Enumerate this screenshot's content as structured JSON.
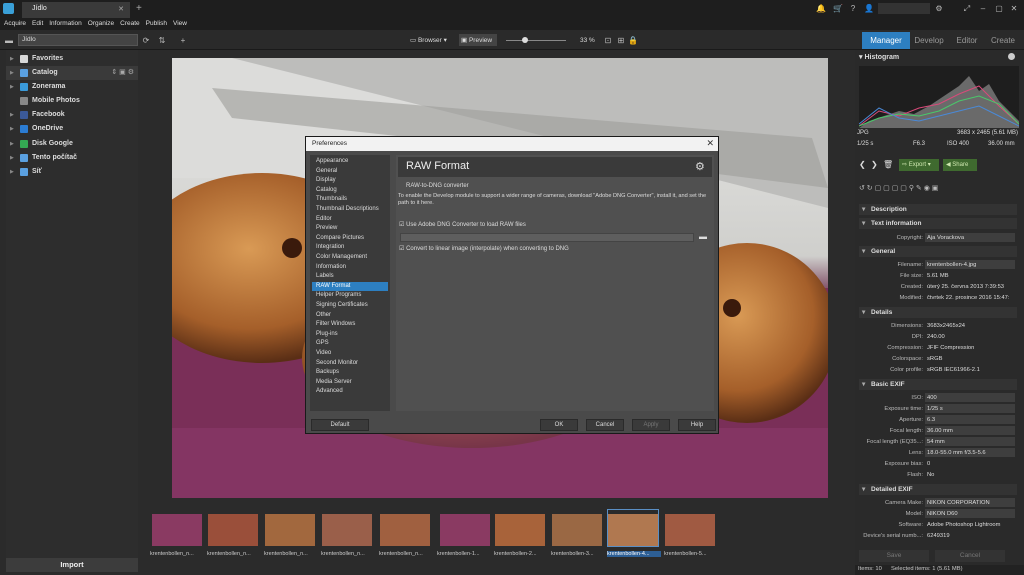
{
  "titlebar": {
    "tab_title": "Jídlo",
    "new_tab": "+"
  },
  "menu": [
    "Acquire",
    "Edit",
    "Information",
    "Organize",
    "Create",
    "Publish",
    "View"
  ],
  "toolbar": {
    "path": "Jídlo",
    "browser_label": "Browser",
    "preview_label": "Preview",
    "zoom": "33 %"
  },
  "modes": [
    "Manager",
    "Develop",
    "Editor",
    "Create"
  ],
  "nav": [
    {
      "label": "Favorites",
      "icon": "star-icon",
      "color": "#d8d8d8"
    },
    {
      "label": "Catalog",
      "icon": "catalog-icon",
      "color": "#5aa0e0"
    },
    {
      "label": "Zonerama",
      "icon": "cloud-icon",
      "color": "#3a9ad9"
    },
    {
      "label": "Mobile Photos",
      "icon": "phone-icon",
      "color": "#888888"
    },
    {
      "label": "Facebook",
      "icon": "facebook-icon",
      "color": "#3b5998"
    },
    {
      "label": "OneDrive",
      "icon": "onedrive-icon",
      "color": "#2b7cd3"
    },
    {
      "label": "Disk Google",
      "icon": "google-drive-icon",
      "color": "#34a853"
    },
    {
      "label": "Tento počítač",
      "icon": "computer-icon",
      "color": "#5aa0e0"
    },
    {
      "label": "Síť",
      "icon": "network-icon",
      "color": "#5aa0e0"
    }
  ],
  "import_label": "Import",
  "dialog": {
    "title": "Preferences",
    "categories": [
      "Appearance",
      "General",
      "Display",
      "Catalog",
      "Thumbnails",
      "Thumbnail Descriptions",
      "Editor",
      "Preview",
      "Compare Pictures",
      "Integration",
      "Color Management",
      "Information",
      "Labels",
      "RAW Format",
      "Helper Programs",
      "Signing Certificates",
      "Other",
      "Filter Windows",
      "Plug-ins",
      "GPS",
      "Video",
      "Second Monitor",
      "Backups",
      "Media Server",
      "Advanced"
    ],
    "selected": "RAW Format",
    "panel_title": "RAW Format",
    "section": "RAW-to-DNG converter",
    "description": "To enable the Develop module to support a wider range of cameras, download \"Adobe DNG Converter\", install it, and set the path to it here.",
    "checkbox1": "Use Adobe DNG Converter to load RAW files",
    "checkbox2": "Convert to linear image (interpolate) when converting to DNG",
    "buttons": {
      "default": "Default",
      "ok": "OK",
      "cancel": "Cancel",
      "apply": "Apply",
      "help": "Help"
    }
  },
  "right": {
    "histogram_title": "Histogram",
    "format": "JPG",
    "dims": "3683 x 2465 (5.61 MB)",
    "shutter": "1/25 s",
    "aperture": "F6.3",
    "iso": "ISO 400",
    "focal": "36.00 mm",
    "export": "Export",
    "share": "Share",
    "sections": [
      "Description",
      "Text information",
      "General",
      "Details",
      "Basic EXIF",
      "Detailed EXIF"
    ],
    "text_info": [
      {
        "k": "Copyright:",
        "v": "Aja Vorackova"
      }
    ],
    "general": [
      {
        "k": "Filename:",
        "v": "krentenbollen-4.jpg"
      },
      {
        "k": "File size:",
        "v": "5.61 MB"
      },
      {
        "k": "Created:",
        "v": "úterý 25. června 2013 7:39:53"
      },
      {
        "k": "Modified:",
        "v": "čtvrtek 22. prosince 2016 15:47:"
      }
    ],
    "details": [
      {
        "k": "Dimensions:",
        "v": "3683x2465x24"
      },
      {
        "k": "DPI:",
        "v": "240.00"
      },
      {
        "k": "Compression:",
        "v": "JFIF Compression"
      },
      {
        "k": "Colorspace:",
        "v": "sRGB"
      },
      {
        "k": "Color profile:",
        "v": "sRGB IEC61966-2.1"
      }
    ],
    "exif": [
      {
        "k": "ISO:",
        "v": "400"
      },
      {
        "k": "Exposure time:",
        "v": "1/25 s"
      },
      {
        "k": "Aperture:",
        "v": "6.3"
      },
      {
        "k": "Focal length:",
        "v": "36.00 mm"
      },
      {
        "k": "Focal length (EQ35...:",
        "v": "54 mm"
      },
      {
        "k": "Lens:",
        "v": "18.0-55.0 mm f/3.5-5.6"
      },
      {
        "k": "Exposure bias:",
        "v": "0"
      },
      {
        "k": "Flash:",
        "v": "No"
      }
    ],
    "dexif": [
      {
        "k": "Camera Make:",
        "v": "NIKON CORPORATION"
      },
      {
        "k": "Model:",
        "v": "NIKON D60"
      },
      {
        "k": "Software:",
        "v": "Adobe Photoshop Lightroom"
      },
      {
        "k": "Device's serial numb...:",
        "v": "6249319"
      }
    ],
    "save": "Save",
    "cancel": "Cancel"
  },
  "status": {
    "items": "Items: 10",
    "selected": "Selected items: 1 (5.61 MB)"
  },
  "thumbs": [
    "krentenbollen_n...",
    "krentenbollen_n...",
    "krentenbollen_n...",
    "krentenbollen_n...",
    "krentenbollen_n...",
    "krentenbollen-1...",
    "krentenbollen-2...",
    "krentenbollen-3...",
    "krentenbollen-4...",
    "krentenbollen-5..."
  ]
}
